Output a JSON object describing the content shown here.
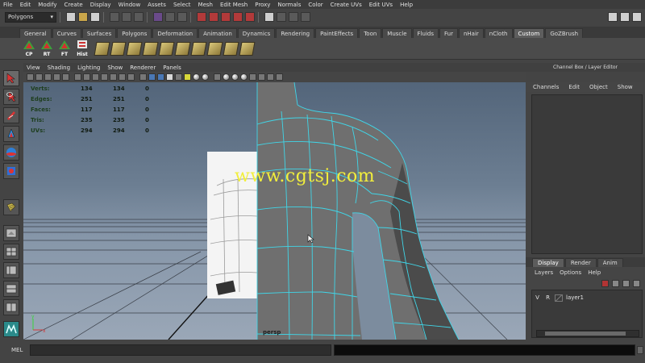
{
  "menubar": [
    "File",
    "Edit",
    "Modify",
    "Create",
    "Display",
    "Window",
    "Assets",
    "Select",
    "Mesh",
    "Edit Mesh",
    "Proxy",
    "Normals",
    "Color",
    "Create UVs",
    "Edit UVs",
    "Help"
  ],
  "statusline": {
    "mode": "Polygons"
  },
  "shelf_tabs": [
    "General",
    "Curves",
    "Surfaces",
    "Polygons",
    "Deformation",
    "Animation",
    "Dynamics",
    "Rendering",
    "PaintEffects",
    "Toon",
    "Muscle",
    "Fluids",
    "Fur",
    "nHair",
    "nCloth",
    "Custom",
    "GoZBrush"
  ],
  "shelf_active_tab": "Custom",
  "shelf_buttons": [
    {
      "label": "CP",
      "icon": "cp-icon"
    },
    {
      "label": "RT",
      "icon": "rt-icon"
    },
    {
      "label": "FT",
      "icon": "ft-icon"
    },
    {
      "label": "Hist",
      "icon": "history-icon"
    }
  ],
  "viewport": {
    "menus": [
      "View",
      "Shading",
      "Lighting",
      "Show",
      "Renderer",
      "Panels"
    ],
    "camera_label": "persp",
    "hud": [
      {
        "label": "Verts:",
        "v1": "134",
        "v2": "134",
        "v3": "0"
      },
      {
        "label": "Edges:",
        "v1": "251",
        "v2": "251",
        "v3": "0"
      },
      {
        "label": "Faces:",
        "v1": "117",
        "v2": "117",
        "v3": "0"
      },
      {
        "label": "Tris:",
        "v1": "235",
        "v2": "235",
        "v3": "0"
      },
      {
        "label": "UVs:",
        "v1": "294",
        "v2": "294",
        "v3": "0"
      }
    ],
    "watermark": "www.cgtsj.com",
    "axis": {
      "x": "x",
      "y": "y"
    }
  },
  "channel_box": {
    "title": "Channel Box / Layer Editor",
    "menus": [
      "Channels",
      "Edit",
      "Object",
      "Show"
    ]
  },
  "layer_editor": {
    "tabs": [
      "Display",
      "Render",
      "Anim"
    ],
    "active_tab": "Display",
    "menus": [
      "Layers",
      "Options",
      "Help"
    ],
    "layer": {
      "visibility": "V",
      "render": "R",
      "name": "layer1"
    }
  },
  "command_line": {
    "label": "MEL",
    "value": ""
  },
  "colors": {
    "wireframe": "#40d6e8",
    "watermark": "#f2ef3c",
    "sky_top": "#53657a",
    "sky_bottom": "#9aa7b7"
  }
}
